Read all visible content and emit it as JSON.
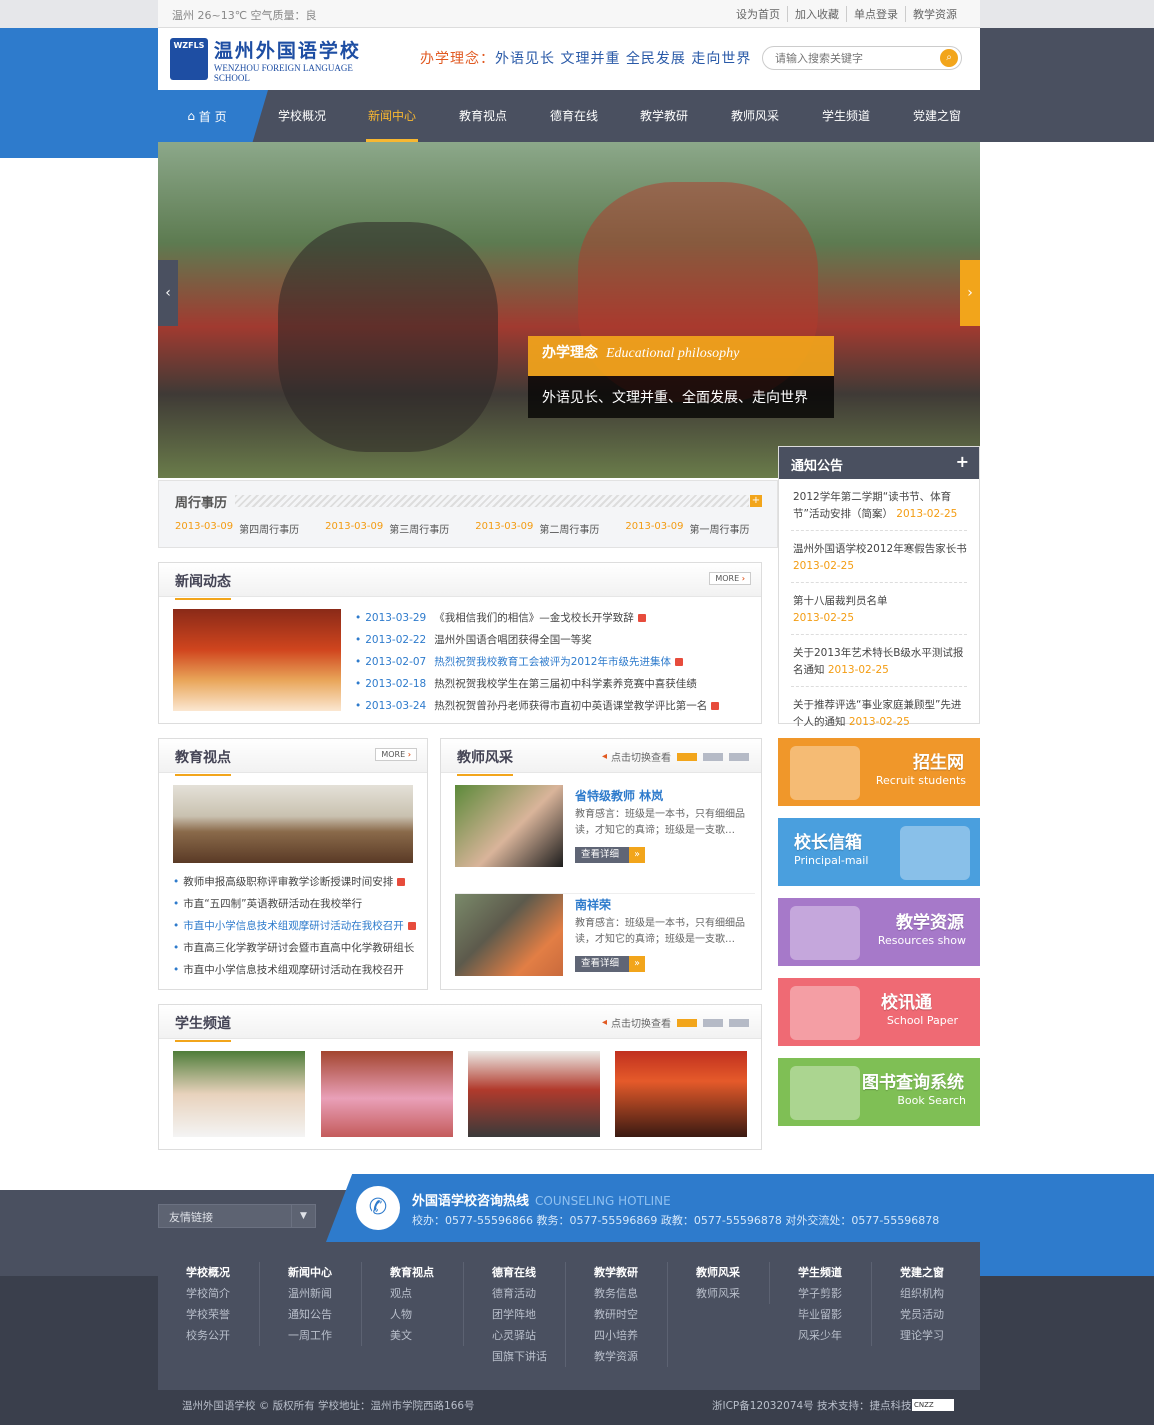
{
  "topbar": {
    "weather": "温州 26~13℃ 空气质量：良",
    "links": [
      "设为首页",
      "加入收藏",
      "单点登录",
      "教学资源"
    ]
  },
  "header": {
    "logo_abbr": "WZFLS",
    "logo_cn": "温州外国语学校",
    "logo_en": "WENZHOU FOREIGN LANGUAGE SCHOOL",
    "motto_label": "办学理念：",
    "motto": "外语见长 文理并重 全民发展 走向世界",
    "search_placeholder": "请输入搜索关键字"
  },
  "nav": {
    "home": "首 页",
    "items": [
      "学校概况",
      "新闻中心",
      "教育视点",
      "德育在线",
      "教学教研",
      "教师风采",
      "学生频道",
      "党建之窗"
    ],
    "active": "新闻中心"
  },
  "banner": {
    "caption_cn": "办学理念",
    "caption_en": "Educational philosophy",
    "subtitle": "外语见长、文理并重、全面发展、走向世界",
    "prev": "‹",
    "next": "›"
  },
  "weekly": {
    "title": "周行事历",
    "items": [
      {
        "date": "2013-03-09",
        "title": "第四周行事历"
      },
      {
        "date": "2013-03-09",
        "title": "第三周行事历"
      },
      {
        "date": "2013-03-09",
        "title": "第二周行事历"
      },
      {
        "date": "2013-03-09",
        "title": "第一周行事历"
      }
    ]
  },
  "notice": {
    "title": "通知公告",
    "items": [
      {
        "text": "2012学年第二学期“读书节、体育节”活动安排（简案）",
        "date": "2013-02-25"
      },
      {
        "text": "温州外国语学校2012年寒假告家长书",
        "date": "2013-02-25"
      },
      {
        "text": "第十八届裁判员名单",
        "date": "2013-02-25"
      },
      {
        "text": "关于2013年艺术特长B级水平测试报名通知",
        "date": "2013-02-25"
      },
      {
        "text": "关于推荐评选“事业家庭兼顾型”先进个人的通知",
        "date": "2013-02-25"
      }
    ]
  },
  "news": {
    "title": "新闻动态",
    "more": "MORE",
    "items": [
      {
        "date": "2013-03-29",
        "title": "《我相信我们的相信》—金戈校长开学致辞",
        "new": true,
        "hl": false
      },
      {
        "date": "2013-02-22",
        "title": "温州外国语合唱团获得全国一等奖",
        "new": false,
        "hl": false
      },
      {
        "date": "2013-02-07",
        "title": "热烈祝贺我校教育工会被评为2012年市级先进集体",
        "new": true,
        "hl": true
      },
      {
        "date": "2013-02-18",
        "title": "热烈祝贺我校学生在第三届初中科学素养竞赛中喜获佳绩",
        "new": false,
        "hl": false
      },
      {
        "date": "2013-03-24",
        "title": "热烈祝贺曾孙丹老师获得市直初中英语课堂教学评比第一名",
        "new": true,
        "hl": false
      }
    ]
  },
  "edu": {
    "title": "教育视点",
    "more": "MORE",
    "items": [
      {
        "title": "教师申报高级职称评审教学诊断授课时间安排",
        "new": true,
        "hl": false
      },
      {
        "title": "市直“五四制”英语教研活动在我校举行",
        "new": false,
        "hl": false
      },
      {
        "title": "市直中小学信息技术组观摩研讨活动在我校召开",
        "new": true,
        "hl": true
      },
      {
        "title": "市直高三化学教学研讨会暨市直高中化学教研组长",
        "new": false,
        "hl": false
      },
      {
        "title": "市直中小学信息技术组观摩研讨活动在我校召开",
        "new": false,
        "hl": false
      }
    ]
  },
  "teachers": {
    "title": "教师风采",
    "switch": "点击切换查看",
    "items": [
      {
        "name": "省特级教师  林岚",
        "desc": "教育感言：班级是一本书，只有细细品读，才知它的真谛；班级是一支歌…",
        "btn": "查看详细"
      },
      {
        "name": "南祥荣",
        "desc": "教育感言：班级是一本书，只有细细品读，才知它的真谛；班级是一支歌…",
        "btn": "查看详细"
      }
    ]
  },
  "side_banners": [
    {
      "cn": "招生网",
      "en": "Recruit students",
      "color": "#f0972a"
    },
    {
      "cn": "校长信箱",
      "en": "Principal-mail",
      "color": "#4a9fde"
    },
    {
      "cn": "教学资源",
      "en": "Resources show",
      "color": "#a679c9"
    },
    {
      "cn": "校讯通",
      "en": "School Paper",
      "color": "#ef6a74"
    },
    {
      "cn": "图书查询系统",
      "en": "Book Search",
      "color": "#7fbf55"
    }
  ],
  "students": {
    "title": "学生频道",
    "switch": "点击切换查看"
  },
  "footer": {
    "friend_links": "友情链接",
    "hotline_title": "外国语学校咨询热线",
    "hotline_en": "COUNSELING HOTLINE",
    "hotline_numbers": "校办：0577-55596866    教务：0577-55596869    政教：0577-55596878    对外交流处：0577-55596878",
    "columns": [
      {
        "head": "学校概况",
        "links": [
          "学校简介",
          "学校荣誉",
          "校务公开"
        ]
      },
      {
        "head": "新闻中心",
        "links": [
          "温州新闻",
          "通知公告",
          "一周工作"
        ]
      },
      {
        "head": "教育视点",
        "links": [
          "观点",
          "人物",
          "美文"
        ]
      },
      {
        "head": "德育在线",
        "links": [
          "德育活动",
          "团学阵地",
          "心灵驿站",
          "国旗下讲话"
        ]
      },
      {
        "head": "教学教研",
        "links": [
          "教务信息",
          "教研时空",
          "四小培养",
          "教学资源"
        ]
      },
      {
        "head": "教师风采",
        "links": [
          "教师风采"
        ]
      },
      {
        "head": "学生频道",
        "links": [
          "学子剪影",
          "毕业留影",
          "风采少年"
        ]
      },
      {
        "head": "党建之窗",
        "links": [
          "组织机构",
          "党员活动",
          "理论学习"
        ]
      }
    ],
    "copyright": "温州外国语学校 © 版权所有   学校地址：温州市学院西路166号",
    "icp": "浙ICP备12032074号   技术支持：捷点科技",
    "cnzz": "CNZZ"
  }
}
